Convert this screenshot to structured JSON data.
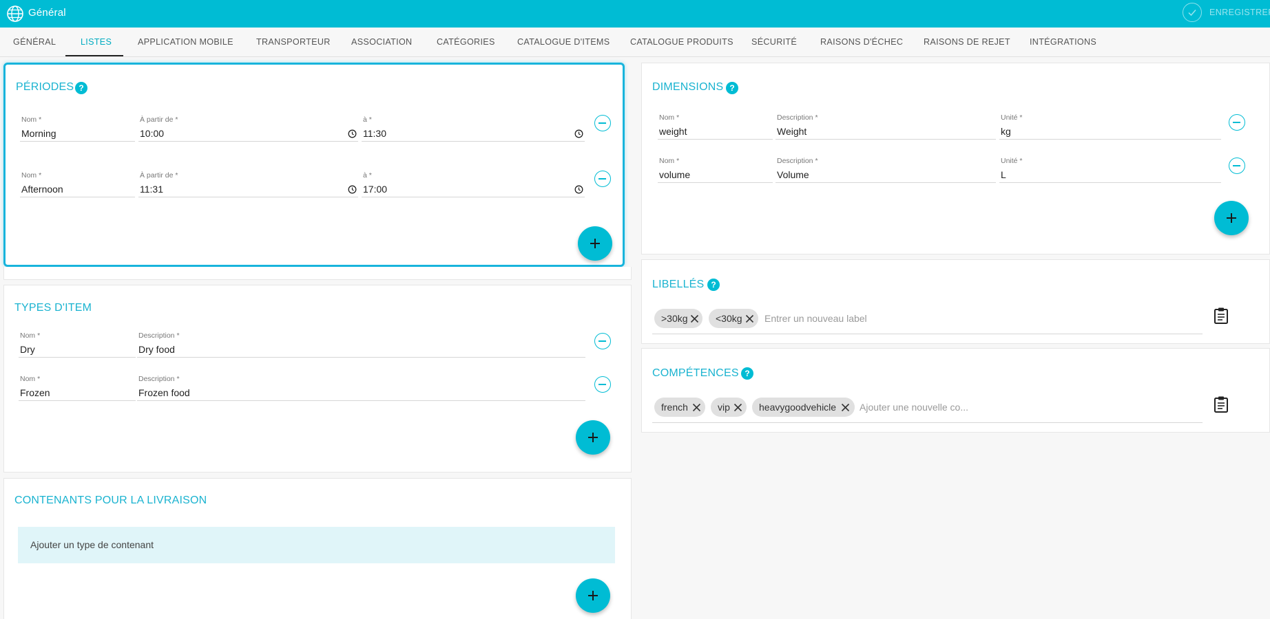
{
  "appbar": {
    "title": "Général",
    "save_label": "ENREGISTRER"
  },
  "tabs": [
    {
      "label": "GÉNÉRAL"
    },
    {
      "label": "LISTES"
    },
    {
      "label": "APPLICATION MOBILE"
    },
    {
      "label": "TRANSPORTEUR"
    },
    {
      "label": "ASSOCIATION"
    },
    {
      "label": "CATÉGORIES"
    },
    {
      "label": "CATALOGUE D'ITEMS"
    },
    {
      "label": "CATALOGUE PRODUITS"
    },
    {
      "label": "SÉCURITÉ"
    },
    {
      "label": "RAISONS D'ÉCHEC"
    },
    {
      "label": "RAISONS DE REJET"
    },
    {
      "label": "INTÉGRATIONS"
    }
  ],
  "active_tab": "LISTES",
  "periodes": {
    "title": "PÉRIODES",
    "help": "?",
    "rows": [
      {
        "nom_label": "Nom *",
        "nom": "Morning",
        "from_label": "À partir de *",
        "from": "10:00",
        "to_label": "à *",
        "to": "11:30"
      },
      {
        "nom_label": "Nom *",
        "nom": "Afternoon",
        "from_label": "À partir de *",
        "from": "11:31",
        "to_label": "à *",
        "to": "17:00"
      }
    ]
  },
  "types_item": {
    "title": "TYPES D'ITEM",
    "rows": [
      {
        "nom_label": "Nom *",
        "nom": "Dry",
        "desc_label": "Description *",
        "desc": "Dry food"
      },
      {
        "nom_label": "Nom *",
        "nom": "Frozen",
        "desc_label": "Description *",
        "desc": "Frozen food"
      }
    ]
  },
  "contenants": {
    "title": "CONTENANTS POUR LA LIVRAISON",
    "empty_text": "Ajouter un type de contenant"
  },
  "dimensions": {
    "title": "DIMENSIONS",
    "help": "?",
    "rows": [
      {
        "nom_label": "Nom *",
        "nom": "weight",
        "desc_label": "Description *",
        "desc": "Weight",
        "unit_label": "Unité *",
        "unit": "kg"
      },
      {
        "nom_label": "Nom *",
        "nom": "volume",
        "desc_label": "Description *",
        "desc": "Volume",
        "unit_label": "Unité *",
        "unit": "L"
      }
    ]
  },
  "libelles": {
    "title": "LIBELLÉS",
    "help": "?",
    "chips": [
      ">30kg",
      "<30kg"
    ],
    "placeholder": "Entrer un nouveau label"
  },
  "competences": {
    "title": "COMPÉTENCES",
    "help": "?",
    "chips": [
      "french",
      "vip",
      "heavygoodvehicle"
    ],
    "placeholder": "Ajouter une nouvelle co..."
  },
  "colors": {
    "accent": "#00bcd4",
    "title": "#1ab3d0",
    "focus_border": "#18b4dc"
  },
  "icons": [
    "globe-icon",
    "check-icon",
    "help-icon",
    "clock-icon",
    "remove-circle-icon",
    "add-icon",
    "close-icon",
    "clipboard-icon"
  ]
}
